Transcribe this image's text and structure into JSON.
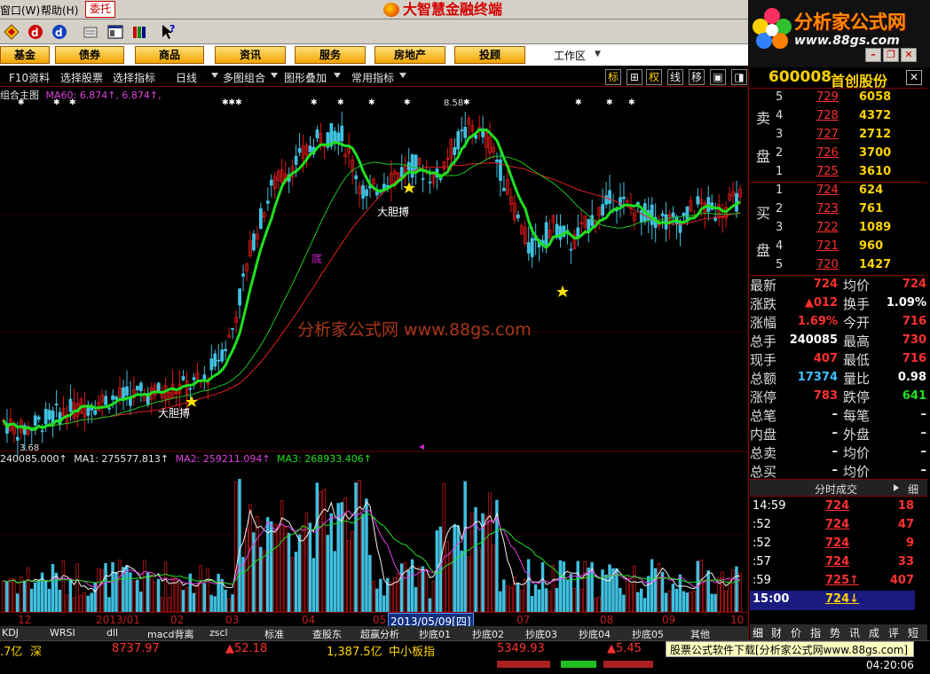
{
  "menu": {
    "items": [
      "窗口(W)",
      "帮助(H)"
    ],
    "weituo": "委托",
    "app_title": "大智慧金融终端"
  },
  "brand": {
    "name": "分析家公式网",
    "url": "www.88gs.com"
  },
  "categories": [
    "基金",
    "债券",
    "商品",
    "资讯",
    "服务",
    "房地产",
    "投顾"
  ],
  "workarea": "工作区",
  "chart_toolbar": {
    "left": [
      "F10资料",
      "选择股票",
      "选择指标",
      "日线",
      "多图组合",
      "图形叠加",
      "常用指标"
    ],
    "right": [
      "标",
      "⊞",
      "权",
      "线",
      "移",
      "▣",
      "◨"
    ]
  },
  "chart": {
    "main_label": "组合主图",
    "ma60_label": "MA60: 6.874↑, 6.874↑,",
    "high_label": "8.58",
    "low_label": "3.68",
    "annotations": [
      "大胆搏",
      "大胆搏",
      "底"
    ],
    "watermark": "分析家公式网  www.88gs.com",
    "vol_legend": {
      "vol": "240085.000↑",
      "ma1": "MA1: 275577.813↑",
      "ma2": "MA2: 259211.094↑",
      "ma3": "MA3: 268933.406↑"
    },
    "axis_labels": [
      "12",
      "2013/01",
      "02",
      "03",
      "04",
      "05",
      "07",
      "08",
      "09",
      "10"
    ],
    "axis_selected": "2013/05/09[四]",
    "colors": {
      "up": "#e01818",
      "down": "#40c0e0",
      "green": "#20e020",
      "ma60": "#e02020",
      "ma_slow": "#20c020"
    }
  },
  "chart_data": {
    "type": "candlestick",
    "title": "组合主图",
    "y_high": 8.58,
    "y_low": 3.68,
    "ma60_last": 6.874,
    "volume_last": 240085.0,
    "ma1": 275577.813,
    "ma2": 259211.094,
    "ma3": 268933.406
  },
  "indicator_tabs": [
    "KDJ",
    "WRSI",
    "dll",
    "macd背离",
    "zscl",
    "标准",
    "查股东",
    "超赢分析",
    "抄底01",
    "抄底02",
    "抄底03",
    "抄底04",
    "抄底05",
    "其他"
  ],
  "status_bar": {
    "items": [
      {
        "text": ".7亿",
        "color": "#ffd400"
      },
      {
        "text": "深",
        "color": "#ffd400"
      },
      {
        "text": "8737.97",
        "color": "#ff3030"
      },
      {
        "text": "▲52.18",
        "color": "#ff3030"
      },
      {
        "text": "1,387.5亿",
        "color": "#ffd400"
      },
      {
        "text": "中小板指",
        "color": "#ffd400"
      },
      {
        "text": "5349.93",
        "color": "#ff3030"
      },
      {
        "text": "▲5.45",
        "color": "#ff3030"
      }
    ],
    "ad": "股票公式软件下载[分析家公式网www.88gs.com]",
    "clock": "04:20:06"
  },
  "quote": {
    "code": "600008",
    "name": "首创股份",
    "sell_label": [
      "卖",
      "盘"
    ],
    "buy_label": [
      "买",
      "盘"
    ],
    "sell": [
      {
        "lvl": "5",
        "price": "729",
        "vol": "6058"
      },
      {
        "lvl": "4",
        "price": "728",
        "vol": "4372"
      },
      {
        "lvl": "3",
        "price": "727",
        "vol": "2712"
      },
      {
        "lvl": "2",
        "price": "726",
        "vol": "3700"
      },
      {
        "lvl": "1",
        "price": "725",
        "vol": "3610"
      }
    ],
    "buy": [
      {
        "lvl": "1",
        "price": "724",
        "vol": "624"
      },
      {
        "lvl": "2",
        "price": "723",
        "vol": "761"
      },
      {
        "lvl": "3",
        "price": "722",
        "vol": "1089"
      },
      {
        "lvl": "4",
        "price": "721",
        "vol": "960"
      },
      {
        "lvl": "5",
        "price": "720",
        "vol": "1427"
      }
    ],
    "stats": [
      {
        "l1": "最新",
        "v1": "724",
        "c1": "#ff3030",
        "l2": "均价",
        "v2": "724",
        "c2": "#ff3030"
      },
      {
        "l1": "涨跌",
        "v1": "▲012",
        "c1": "#ff3030",
        "l2": "换手",
        "v2": "1.09%",
        "c2": "#ffffff"
      },
      {
        "l1": "涨幅",
        "v1": "1.69%",
        "c1": "#ff3030",
        "l2": "今开",
        "v2": "716",
        "c2": "#ff3030"
      },
      {
        "l1": "总手",
        "v1": "240085",
        "c1": "#ffffff",
        "l2": "最高",
        "v2": "730",
        "c2": "#ff3030"
      },
      {
        "l1": "现手",
        "v1": "407",
        "c1": "#ff3030",
        "l2": "最低",
        "v2": "716",
        "c2": "#ff3030"
      },
      {
        "l1": "总额",
        "v1": "17374",
        "c1": "#40c0ff",
        "l2": "量比",
        "v2": "0.98",
        "c2": "#ffffff"
      },
      {
        "l1": "涨停",
        "v1": "783",
        "c1": "#ff3030",
        "l2": "跌停",
        "v2": "641",
        "c2": "#20e020"
      },
      {
        "l1": "总笔",
        "v1": "–",
        "c1": "#ffffff",
        "l2": "每笔",
        "v2": "–",
        "c2": "#ffffff"
      },
      {
        "l1": "内盘",
        "v1": "–",
        "c1": "#ffffff",
        "l2": "外盘",
        "v2": "–",
        "c2": "#ffffff"
      },
      {
        "l1": "总卖",
        "v1": "–",
        "c1": "#ffffff",
        "l2": "均价",
        "v2": "–",
        "c2": "#ffffff"
      },
      {
        "l1": "总买",
        "v1": "–",
        "c1": "#ffffff",
        "l2": "均价",
        "v2": "–",
        "c2": "#ffffff"
      }
    ],
    "ticks_title": "分时成交",
    "ticks_btn": "细",
    "ticks": [
      {
        "t": "14:59",
        "p": "724",
        "v": "18"
      },
      {
        "t": ":52",
        "p": "724",
        "v": "47"
      },
      {
        "t": ":52",
        "p": "724",
        "v": "9"
      },
      {
        "t": ":57",
        "p": "724",
        "v": "33"
      },
      {
        "t": ":59",
        "p": "725↑",
        "v": "407"
      },
      {
        "t": "15:00",
        "p": "724↓",
        "v": ""
      }
    ],
    "bottom_tabs": [
      "细",
      "财",
      "价",
      "指",
      "势",
      "讯",
      "成",
      "评",
      "短"
    ]
  }
}
